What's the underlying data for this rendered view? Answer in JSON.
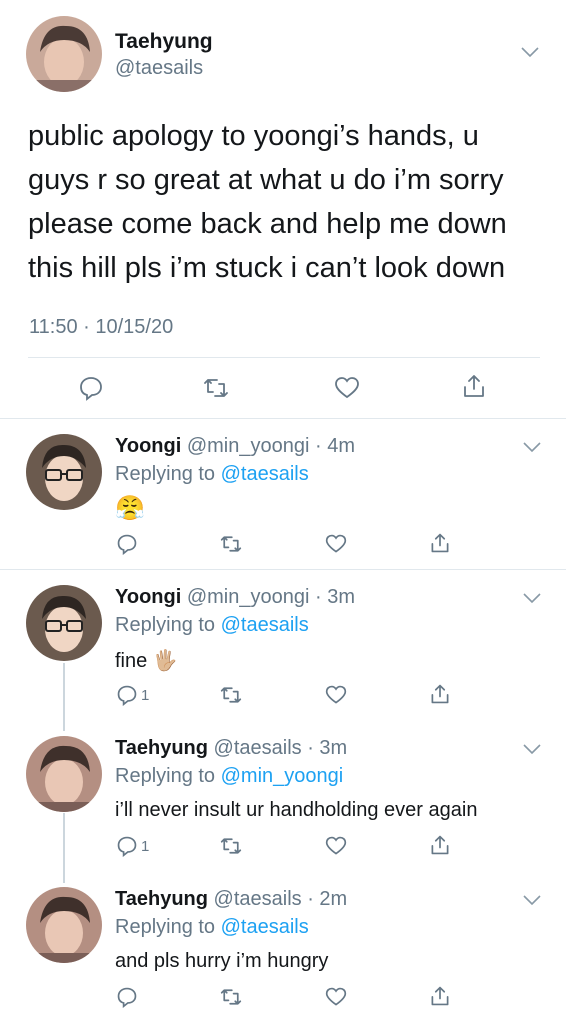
{
  "main_tweet": {
    "name": "Taehyung",
    "handle": "@taesails",
    "text_lines": [
      "public apology to yoongi’s hands, u",
      "guys r so great at what u do i’m sorry",
      "please come back and help me down",
      "this hill pls i’m stuck i can’t look down"
    ],
    "timestamp": "11:50 · 10/15/20",
    "actions": [
      "reply-icon",
      "retweet-icon",
      "like-icon",
      "share-icon"
    ]
  },
  "replies": [
    {
      "name": "Yoongi",
      "meta": "@min_yoongi · 4m",
      "replying_prefix": "Replying to ",
      "replying_to": "@taesails",
      "text": "😤",
      "reply_count": ""
    },
    {
      "name": "Yoongi",
      "meta": "@min_yoongi · 3m",
      "replying_prefix": "Replying to ",
      "replying_to": "@taesails",
      "text": "fine 🖐🏼",
      "reply_count": "1"
    },
    {
      "name": "Taehyung",
      "meta": "@taesails · 3m",
      "replying_prefix": "Replying to ",
      "replying_to": "@min_yoongi",
      "text": "i’ll never insult ur handholding ever again",
      "reply_count": "1"
    },
    {
      "name": "Taehyung",
      "meta": "@taesails · 2m",
      "replying_prefix": "Replying to ",
      "replying_to": "@taesails",
      "text": "and pls hurry i’m hungry",
      "reply_count": ""
    }
  ],
  "colors": {
    "text": "#14171a",
    "muted": "#657786",
    "link": "#1da1f2",
    "divider": "#e1e8ed"
  }
}
